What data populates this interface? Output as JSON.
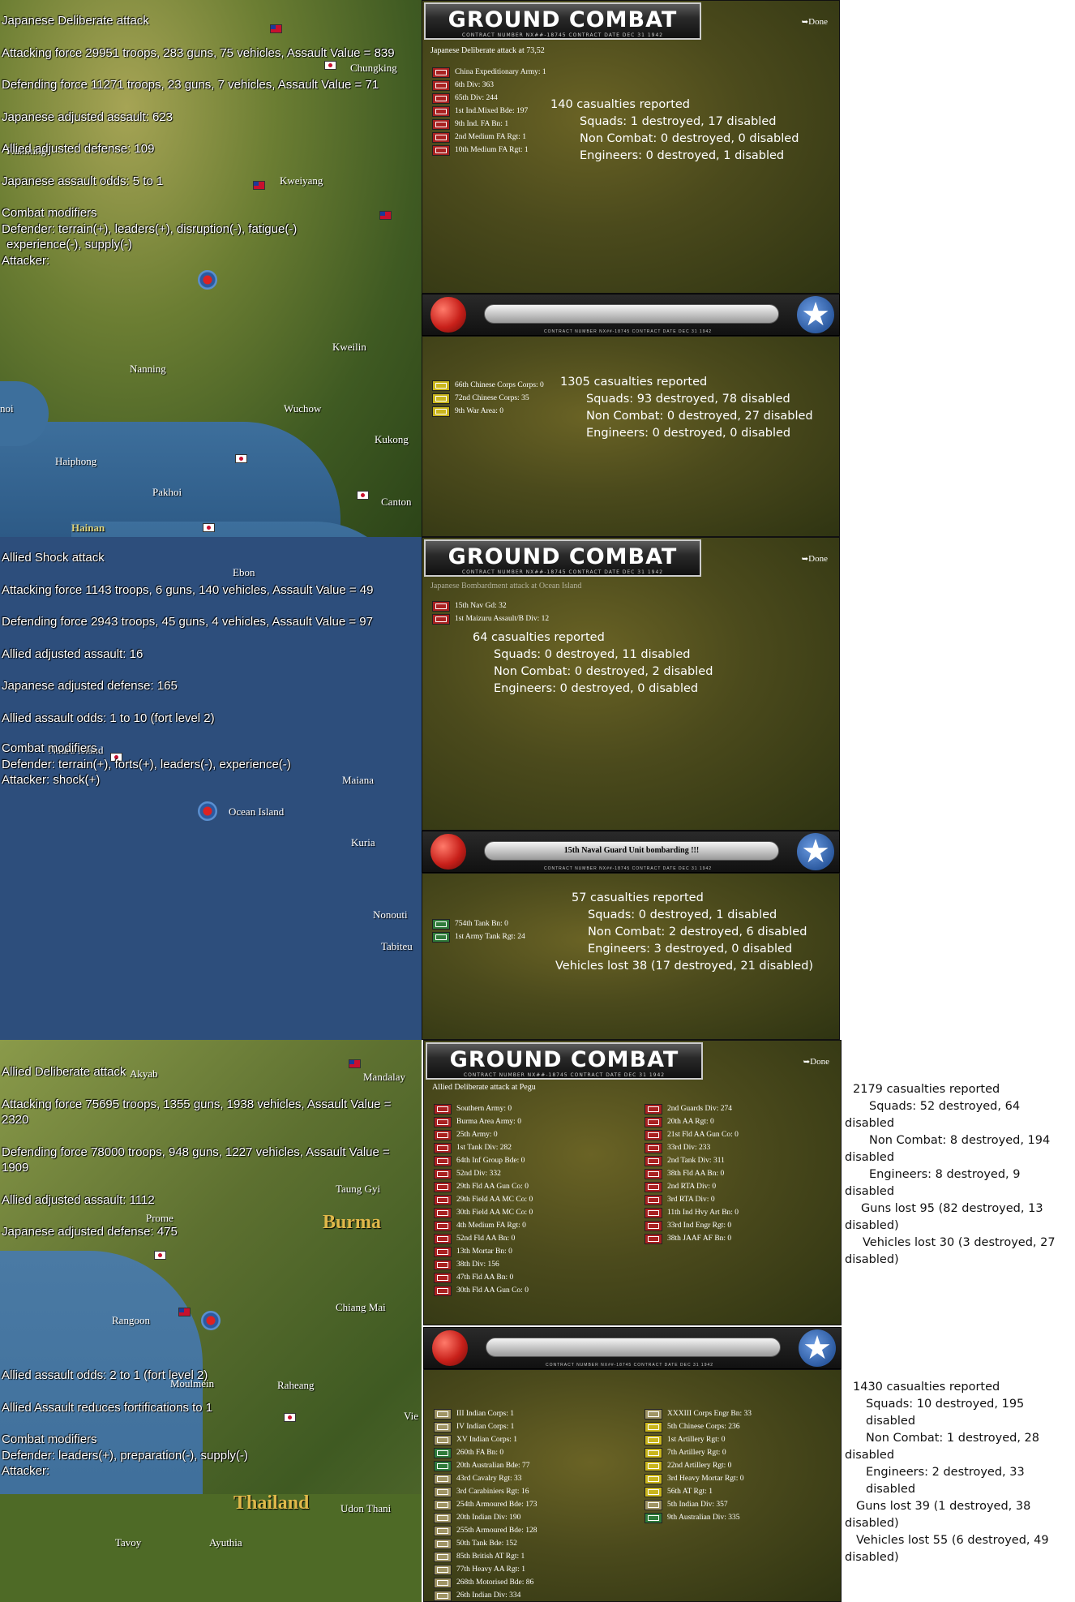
{
  "section1": {
    "map_labels": [
      "Chungking",
      "Kunming",
      "Kweiyang",
      "Kweilin",
      "Nanning",
      "Wuchow",
      "Kukong",
      "Haiphong",
      "Pakhoi",
      "Canton",
      "Hainan",
      "noi"
    ],
    "overlay": {
      "lines": [
        "Japanese Deliberate attack",
        "Attacking force 29951 troops, 283 guns, 75 vehicles, Assault Value = 839",
        "Defending force 11271 troops, 23 guns, 7 vehicles, Assault Value = 71",
        "Japanese adjusted assault: 623",
        "Allied adjusted defense: 109",
        "Japanese assault odds: 5 to 1",
        "Combat modifiers"
      ],
      "defender_mods": "Defender: terrain(+), leaders(+), disruption(-), fatigue(-)",
      "defender_mods2": "experience(-), supply(-)",
      "attacker_mods": "Attacker:"
    },
    "panel_title": "GROUND COMBAT",
    "panel_title_sub": "CONTRACT NUMBER   NX##-18745        CONTRACT DATE  DEC 31  1942",
    "done": "Done",
    "subtitle": "Japanese Deliberate attack at 73,52",
    "attacker_units": [
      "China Expeditionary Army: 1",
      "6th Div: 363",
      "65th Div: 244",
      "1st Ind.Mixed Bde: 197",
      "9th Ind. FA Bn: 1",
      "2nd Medium FA Rgt: 1",
      "10th Medium FA Rgt: 1"
    ],
    "attacker_casualties": [
      "140 casualties reported",
      "Squads: 1 destroyed, 17 disabled",
      "Non Combat: 0 destroyed, 0 disabled",
      "Engineers: 0 destroyed, 1 disabled"
    ],
    "separator_text": "",
    "separator_foot": "CONTRACT NUMBER   NX##-18745        CONTRACT DATE  DEC 31  1942",
    "defender_units": [
      "66th Chinese Corps Corps: 0",
      "72nd Chinese Corps: 35",
      "9th War Area: 0"
    ],
    "defender_casualties": [
      "1305 casualties reported",
      "Squads: 93 destroyed, 78 disabled",
      "Non Combat: 0 destroyed, 27 disabled",
      "Engineers: 0 destroyed, 0 disabled"
    ]
  },
  "section2": {
    "map_labels": [
      "Ebon",
      "Nauru Island",
      "Maiana",
      "Ocean Island",
      "Kuria",
      "Nonouti",
      "Tabiteu"
    ],
    "overlay": {
      "lines": [
        "Allied Shock attack",
        "Attacking force 1143 troops, 6 guns, 140 vehicles, Assault Value = 49",
        "Defending force 2943 troops, 45 guns, 4 vehicles, Assault Value = 97",
        "Allied adjusted assault: 16",
        "Japanese adjusted defense: 165",
        "Allied assault odds: 1 to 10 (fort level 2)",
        "Combat modifiers"
      ],
      "defender_mods": "Defender: terrain(+), forts(+), leaders(-), experience(-)",
      "attacker_mods": "Attacker: shock(+)"
    },
    "panel_title": "GROUND COMBAT",
    "panel_title_sub": "CONTRACT NUMBER   NX##-18745        CONTRACT DATE  DEC 31  1942",
    "done": "Done",
    "subtitle": "Japanese Bombardment attack at Ocean Island",
    "attacker_units": [
      "15th Nav Gd: 32",
      "1st Maizuru Assault/B Div: 12"
    ],
    "attacker_casualties": [
      "64 casualties reported",
      "Squads: 0 destroyed, 11 disabled",
      "Non Combat: 0 destroyed, 2 disabled",
      "Engineers: 0 destroyed, 0 disabled"
    ],
    "separator_text": "15th Naval Guard Unit bombarding !!!",
    "separator_foot": "CONTRACT NUMBER   NX##-18745        CONTRACT DATE  DEC 31  1942",
    "defender_units": [
      "754th Tank Bn: 0",
      "1st Army Tank Rgt: 24"
    ],
    "defender_casualties": [
      "57 casualties reported",
      "Squads: 0 destroyed, 1 disabled",
      "Non Combat: 2 destroyed, 6 disabled",
      "Engineers: 3 destroyed, 0 disabled",
      "Vehicles lost 38 (17 destroyed, 21 disabled)"
    ]
  },
  "section3": {
    "map_labels": [
      "Akyab",
      "Mandalay",
      "Taung Gyi",
      "Prome",
      "Burma",
      "Chiang Mai",
      "Rangoon",
      "Moulmein",
      "Raheang",
      "Thailand",
      "Udon Thani",
      "Tavoy",
      "Ayuthia",
      "Vie"
    ],
    "overlay": {
      "lines": [
        "Allied Deliberate attack",
        "Attacking force 75695 troops, 1355 guns, 1938 vehicles, Assault Value = 2320",
        "Defending force 78000 troops, 948 guns, 1227 vehicles, Assault Value = 1909",
        "Allied adjusted assault: 1112",
        "Japanese adjusted defense: 475"
      ],
      "lines_b": [
        "Allied assault odds: 2 to 1 (fort level 2)",
        "Allied Assault reduces fortifications to 1",
        "Combat modifiers"
      ],
      "defender_mods": "Defender: leaders(+), preparation(-), supply(-)",
      "attacker_mods": "Attacker:"
    },
    "panel_title": "GROUND COMBAT",
    "panel_title_sub": "CONTRACT NUMBER   NX##-18745        CONTRACT DATE  DEC 31  1942",
    "done": "Done",
    "subtitle": "Allied Deliberate attack at Pegu",
    "defender_units_a": [
      "Southern Army: 0",
      "Burma Area Army: 0",
      "25th Army: 0",
      "1st Tank Div: 282",
      "64th Inf Group Bde: 0",
      "52nd Div: 332",
      "29th Fld AA Gun Co: 0",
      "29th Field AA MC Co: 0",
      "30th Field AA MC Co: 0",
      "4th Medium FA Rgt: 0",
      "52nd Fld AA Bn: 0",
      "13th Mortar Bn: 0",
      "38th Div: 156",
      "47th Fld AA Bn: 0",
      "30th Fld AA Gun Co: 0"
    ],
    "defender_units_b": [
      "2nd Guards Div: 274",
      "20th AA Rgt: 0",
      "21st Fld AA Gun Co: 0",
      "33rd Div: 233",
      "2nd Tank Div: 311",
      "38th Fld AA Bn: 0",
      "2nd RTA Div: 0",
      "3rd RTA Div: 0",
      "11th Ind Hvy Art Bn: 0",
      "33rd Ind Engr Rgt: 0",
      "38th JAAF AF Bn: 0"
    ],
    "defender_casualties": [
      "2179 casualties reported",
      "Squads: 52 destroyed, 64",
      "disabled",
      "Non Combat: 8 destroyed, 194",
      "disabled",
      "Engineers: 8 destroyed, 9",
      "disabled",
      "Guns lost 95 (82 destroyed, 13",
      "disabled)",
      "Vehicles lost 30 (3 destroyed, 27",
      "disabled)"
    ],
    "separator_text": "",
    "separator_foot": "CONTRACT NUMBER   NX##-18745        CONTRACT DATE  DEC 31  1942",
    "attacker_units_a": [
      "III Indian Corps: 1",
      "IV Indian Corps: 1",
      "XV Indian Corps: 1",
      "260th FA Bn: 0",
      "20th Australian Bde: 77",
      "43rd Cavalry Rgt: 33",
      "3rd Carabiniers Rgt: 16",
      "254th Armoured Bde: 173",
      "20th Indian Div: 190",
      "255th Armoured Bde: 128",
      "50th Tank Bde: 152",
      "85th British AT Rgt: 1",
      "77th Heavy AA Rgt: 1",
      "268th Motorised Bde: 86",
      "26th Indian Div: 334"
    ],
    "attacker_units_b": [
      "XXXIII Corps Engr Bn: 33",
      "5th Chinese Corps: 236",
      "1st Artillery Rgt: 0",
      "7th Artillery Rgt: 0",
      "22nd Artillery Rgt: 0",
      "3rd Heavy Mortar Rgt: 0",
      "56th AT Rgt: 1",
      "5th Indian Div: 357",
      "9th Australian Div: 335"
    ],
    "attacker_casualties": [
      "1430 casualties reported",
      "Squads: 10 destroyed, 195 disabled",
      "Non Combat: 1 destroyed, 28",
      "disabled",
      "Engineers: 2 destroyed, 33 disabled",
      "Guns lost 39 (1 destroyed, 38",
      "disabled)",
      "Vehicles lost 55 (6 destroyed, 49",
      "disabled)"
    ]
  }
}
